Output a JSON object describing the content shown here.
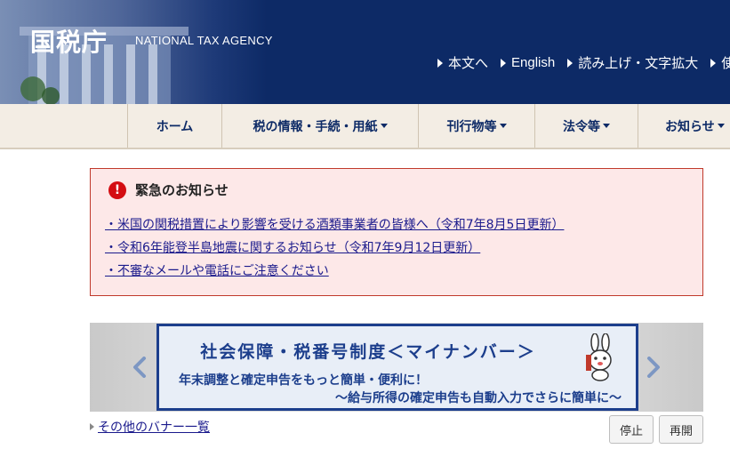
{
  "header": {
    "logo_text": "国税庁",
    "logo_en": "NATIONAL TAX AGENCY",
    "util_links": [
      "本文へ",
      "English",
      "読み上げ・文字拡大",
      "使"
    ]
  },
  "nav": {
    "items": [
      {
        "label": "ホーム",
        "has_dropdown": false
      },
      {
        "label": "税の情報・手続・用紙",
        "has_dropdown": true
      },
      {
        "label": "刊行物等",
        "has_dropdown": true
      },
      {
        "label": "法令等",
        "has_dropdown": true
      },
      {
        "label": "お知らせ",
        "has_dropdown": true
      }
    ]
  },
  "notice": {
    "title": "緊急のお知らせ",
    "links": [
      "・米国の関税措置により影響を受ける酒類事業者の皆様へ（令和7年8月5日更新）",
      "・令和6年能登半島地震に関するお知らせ（令和7年9月12日更新）",
      "・不審なメールや電話にご注意ください"
    ]
  },
  "banner": {
    "title": "社会保障・税番号制度＜マイナンバー＞",
    "subtitle1": "年末調整と確定申告をもっと簡単・便利に！",
    "subtitle2": "～給与所得の確定申告も自動入力でさらに簡単に～",
    "other_link": "その他のバナー一覧",
    "stop_label": "停止",
    "resume_label": "再開"
  },
  "colors": {
    "header_bg": "#0d2a66",
    "nav_bg": "#f3ede4",
    "notice_bg": "#fde8e8",
    "notice_border": "#c0392b",
    "alert_red": "#d40d12",
    "link": "#1a1a8c",
    "banner_blue": "#1c3e8c"
  },
  "icons": [
    "alert-icon",
    "triangle-right-icon",
    "chevron-left-icon",
    "chevron-right-icon",
    "caret-down-icon",
    "mascot-icon"
  ]
}
